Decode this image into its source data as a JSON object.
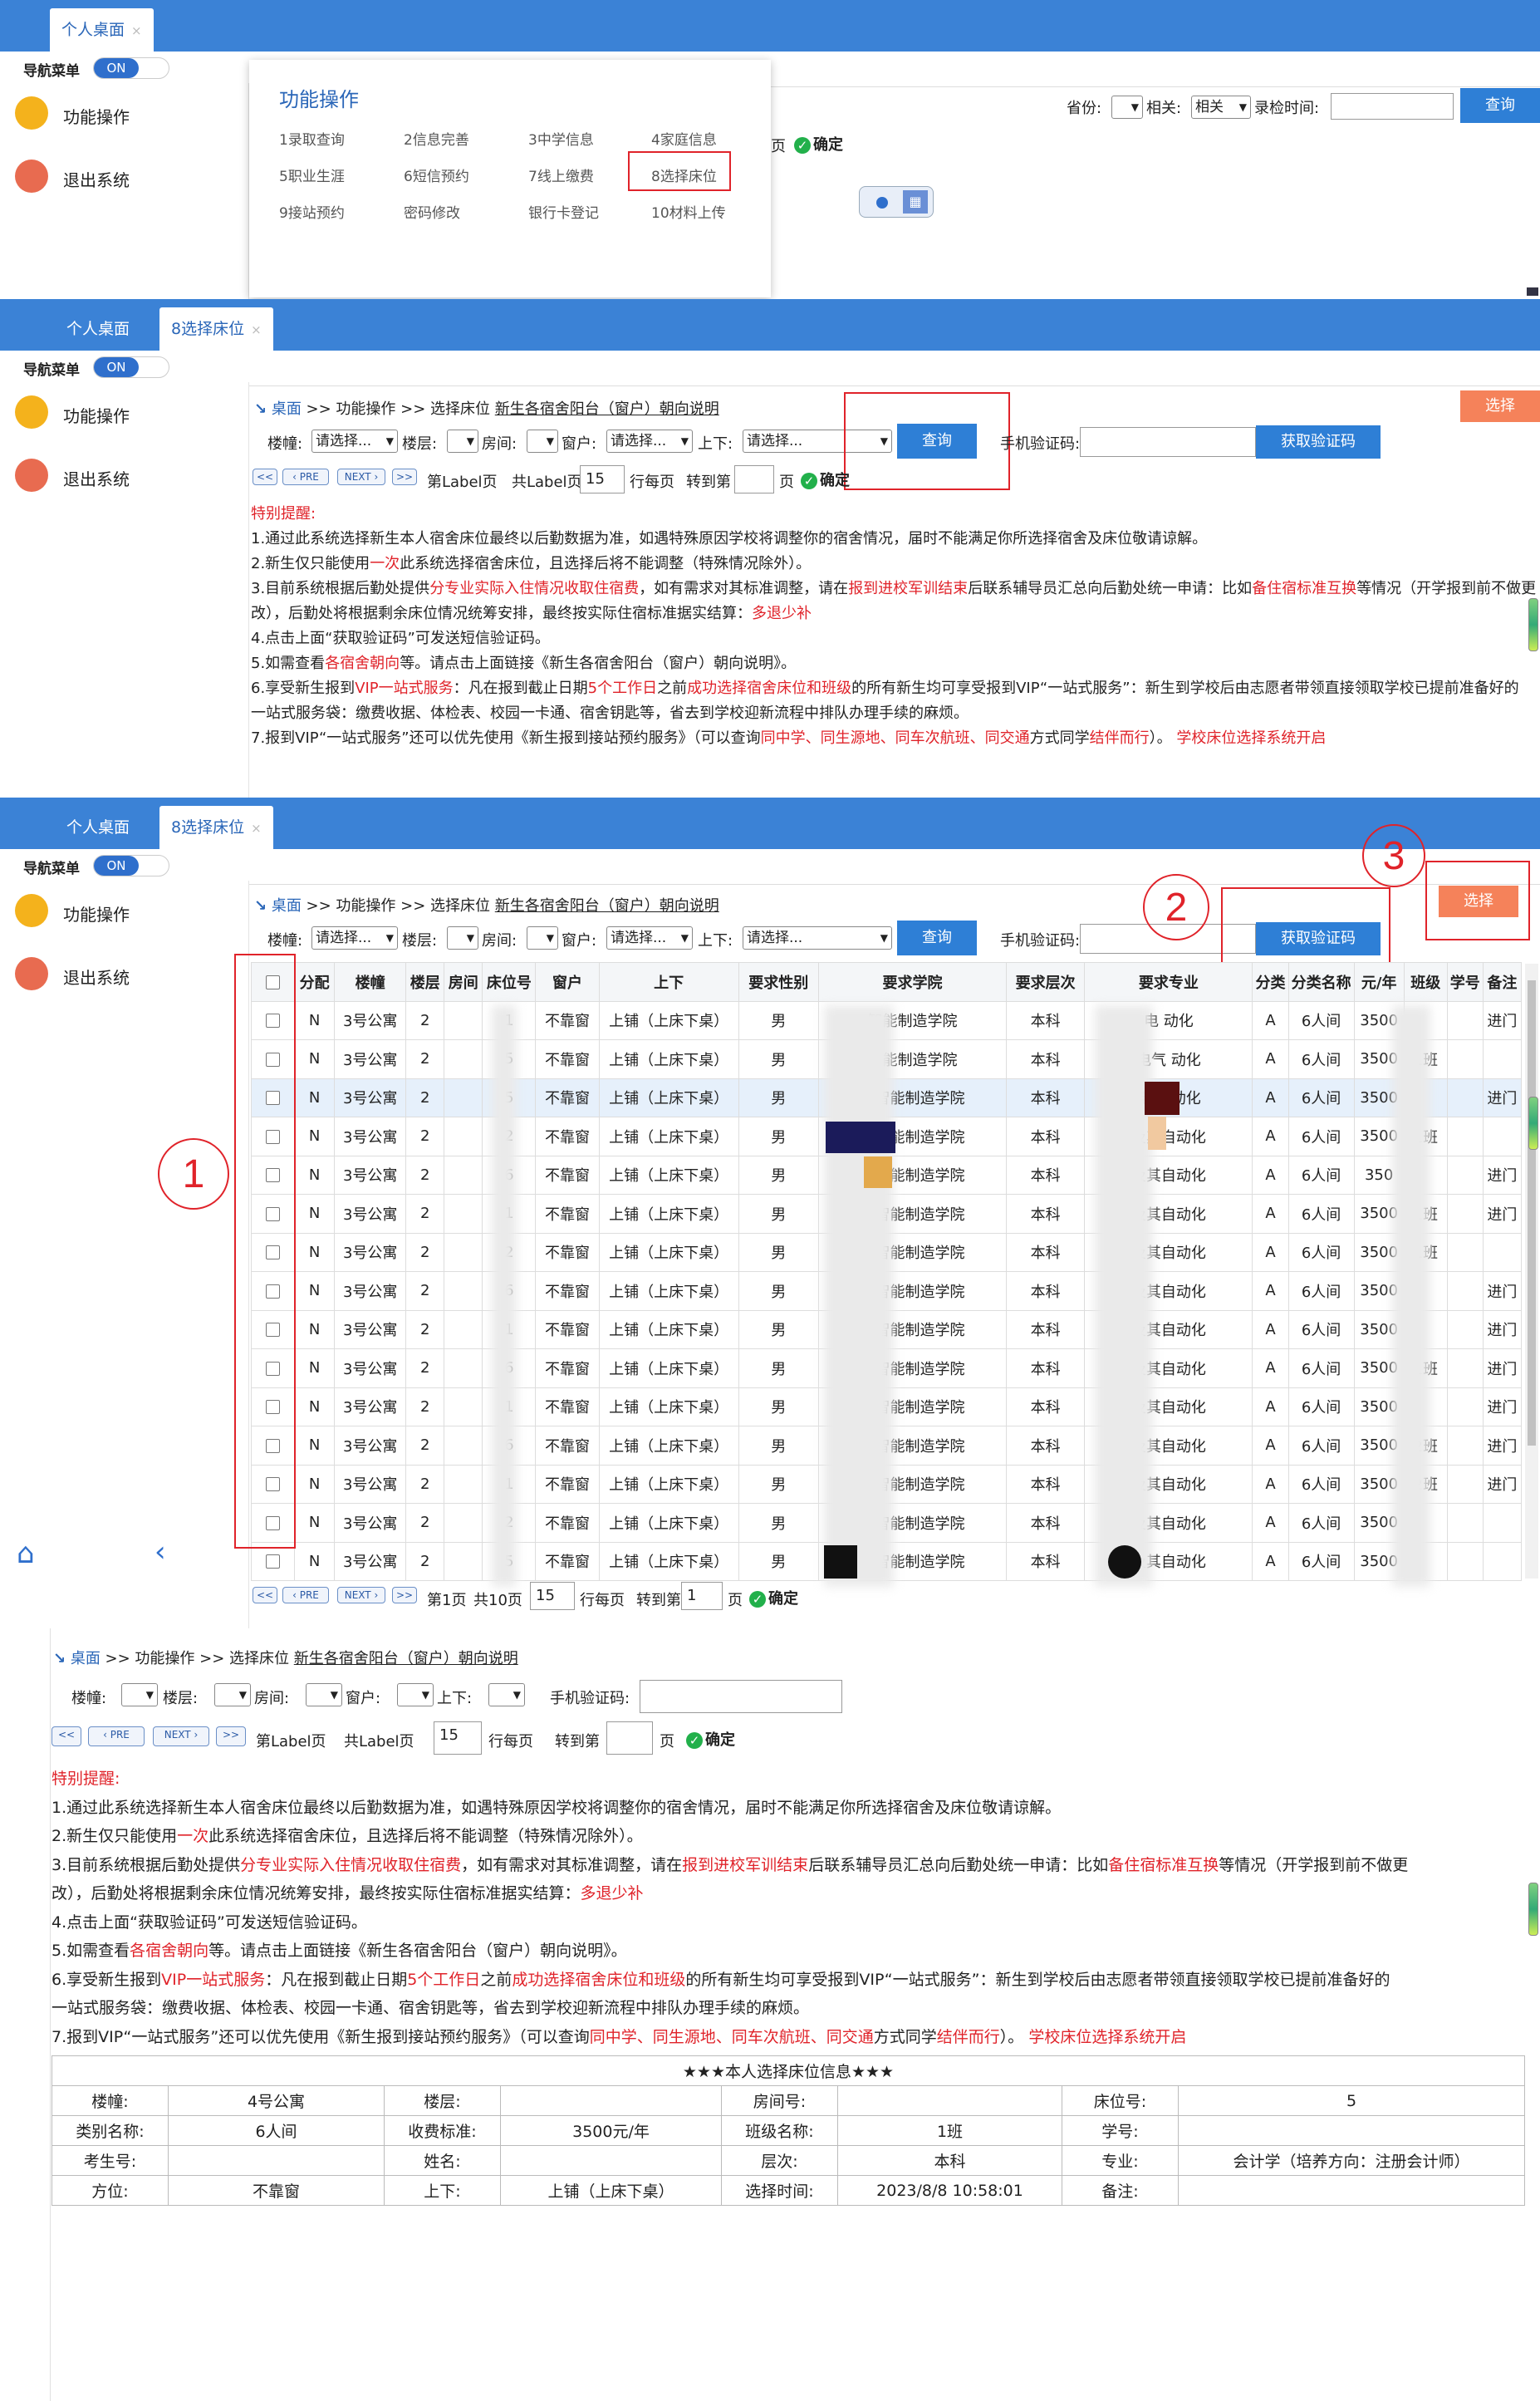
{
  "sec1": {
    "tabs": [
      {
        "label": "个人桌面",
        "close": "×"
      }
    ],
    "nav_label": "导航菜单",
    "toggle": "ON",
    "side": [
      "功能操作",
      "退出系统"
    ],
    "popup": {
      "title": "功能操作",
      "items": [
        "1录取查询",
        "2信息完善",
        "3中学信息",
        "4家庭信息",
        "5职业生涯",
        "6短信预约",
        "7线上缴费",
        "8选择床位",
        "9接站预约",
        "密码修改",
        "银行卡登记",
        "10材料上传"
      ]
    },
    "filters": {
      "province": "省份:",
      "related": "相关:",
      "related_val": "相关",
      "time": "录检时间:",
      "query": "查询"
    },
    "page_tail": "页",
    "confirm": "确定"
  },
  "sec2": {
    "tabs": [
      {
        "label": "个人桌面"
      },
      {
        "label": "8选择床位",
        "close": "×"
      }
    ],
    "nav_label": "导航菜单",
    "toggle": "ON",
    "side": [
      "功能操作",
      "退出系统"
    ],
    "crumb": {
      "desk": "桌面",
      "rest": " >> 功能操作 >> 选择床位 ",
      "link": "新生各宿舍阳台（窗户）朝向说明"
    },
    "select_btn": "选择",
    "filters": {
      "building": "楼幢:",
      "building_val": "请选择...",
      "floor": "楼层:",
      "room": "房间:",
      "window": "窗户:",
      "window_val": "请选择...",
      "updown": "上下:",
      "updown_val": "请选择...",
      "query": "查询",
      "phone": "手机验证码:",
      "get_code": "获取验证码"
    },
    "pager": {
      "prev": "PRE",
      "next": "NEXT",
      "page_label": "第Label页",
      "total_label": "共Label页",
      "per": "15",
      "per_lbl": "行每页",
      "goto": "转到第",
      "page": "页",
      "confirm": "确定"
    }
  },
  "notice": {
    "head": "特别提醒:",
    "l1": "1.通过此系统选择新生本人宿舍床位最终以后勤数据为准，如遇特殊原因学校将调整你的宿舍情况，届时不能满足你所选择宿舍及床位敬请谅解。",
    "l2a": "2.新生仅只能使用",
    "l2b": "一次",
    "l2c": "此系统选择宿舍床位，且选择后将不能调整（特殊情况除外）。",
    "l3a": "3.目前系统根据后勤处提供",
    "l3b": "分专业实际入住情况收取住宿费",
    "l3c": "，如有需求对其标准调整，请在",
    "l3d": "报到进校军训结束",
    "l3e": "后联系辅导员汇总向后勤处统一申请：比如",
    "l3f": "备住宿标准互换",
    "l3g": "等情况（开学报到前不做更",
    "l3h": "改），后勤处将根据剩余床位情况统筹安排，最终按实际住宿标准据实结算：",
    "l3i": "多退少补",
    "l4": "4.点击上面“获取验证码”可发送短信验证码。",
    "l5a": "5.如需查看",
    "l5b": "各宿舍朝向",
    "l5c": "等。请点击上面链接《新生各宿舍阳台（窗户）朝向说明》。",
    "l6a": "6.享受新生报到",
    "l6b": "VIP一站式服务",
    "l6c": "：凡在报到截止日期",
    "l6d": "5个工作日",
    "l6e": "之前",
    "l6f": "成功选择宿舍床位和班级",
    "l6g": "的所有新生均可享受报到VIP“一站式服务”：新生到学校后由志愿者带领直接领取学校已提前准备好的",
    "l6h": "一站式服务袋：缴费收据、体检表、校园一卡通、宿舍钥匙等，省去到学校迎新流程中排队办理手续的麻烦。",
    "l7a": "7.报到VIP“一站式服务”还可以优先使用《新生报到接站预约服务》（可以查询",
    "l7b": "同中学、同生源地、同车次航班、同交通",
    "l7c": "方式同学",
    "l7d": "结伴而行",
    "l7e": "）。",
    "l7f": "学校床位选择系统开启"
  },
  "sec3": {
    "tabs": [
      {
        "label": "个人桌面"
      },
      {
        "label": "8选择床位",
        "close": "×"
      }
    ],
    "nav_label": "导航菜单",
    "toggle": "ON",
    "side": [
      "功能操作",
      "退出系统"
    ],
    "crumb": {
      "desk": "桌面",
      "rest": " >> 功能操作 >> 选择床位 ",
      "link": "新生各宿舍阳台（窗户）朝向说明"
    },
    "select_btn": "选择",
    "annotations": [
      "1",
      "2",
      "3"
    ],
    "filters": {
      "building": "楼幢:",
      "building_val": "请选择...",
      "floor": "楼层:",
      "room": "房间:",
      "window": "窗户:",
      "window_val": "请选择...",
      "updown": "上下:",
      "updown_val": "请选择...",
      "query": "查询",
      "phone": "手机验证码:",
      "get_code": "获取验证码"
    },
    "columns": [
      "分配",
      "楼幢",
      "楼层",
      "房间",
      "床位号",
      "窗户",
      "上下",
      "要求性别",
      "要求学院",
      "要求层次",
      "要求专业",
      "分类",
      "分类名称",
      "元/年",
      "班级",
      "学号",
      "备注"
    ],
    "rows": [
      [
        "N",
        "3号公寓",
        "2",
        "",
        "1",
        "不靠窗",
        "上铺（上床下桌）",
        "男",
        "智能制造学院",
        "本科",
        "电  动化",
        "A",
        "6人间",
        "3500",
        "",
        "",
        "进门"
      ],
      [
        "N",
        "3号公寓",
        "2",
        "",
        "5",
        "不靠窗",
        "上铺（上床下桌）",
        "男",
        "智能制造学院",
        "本科",
        "电气  动化",
        "A",
        "6人间",
        "3500",
        "1班",
        "",
        ""
      ],
      [
        "N",
        "3号公寓",
        "2",
        "",
        "5",
        "不靠窗",
        "上铺（上床下桌）",
        "男",
        "与智能制造学院",
        "本科",
        "电  自动化",
        "A",
        "6人间",
        "3500",
        "",
        "",
        "进门"
      ],
      [
        "N",
        "3号公寓",
        "2",
        "",
        "2",
        "不靠窗",
        "上铺（上床下桌）",
        "男",
        "与智能制造学院",
        "本科",
        "及其自动化",
        "A",
        "6人间",
        "3500",
        "1班",
        "",
        ""
      ],
      [
        "N",
        "3号公寓",
        "2",
        "",
        "6",
        "不靠窗",
        "上铺（上床下桌）",
        "男",
        "与智能制造学院",
        "本科",
        "及其自动化",
        "A",
        "6人间",
        "350",
        "",
        "",
        "进门"
      ],
      [
        "N",
        "3号公寓",
        "2",
        "",
        "1",
        "不靠窗",
        "上铺（上床下桌）",
        "男",
        "与智能制造学院",
        "本科",
        "及其自动化",
        "A",
        "6人间",
        "3500",
        "1班",
        "",
        "进门"
      ],
      [
        "N",
        "3号公寓",
        "2",
        "",
        "2",
        "不靠窗",
        "上铺（上床下桌）",
        "男",
        "与智能制造学院",
        "本科",
        "及其自动化",
        "A",
        "6人间",
        "3500",
        "1班",
        "",
        ""
      ],
      [
        "N",
        "3号公寓",
        "2",
        "",
        "6",
        "不靠窗",
        "上铺（上床下桌）",
        "男",
        "与智能制造学院",
        "本科",
        "及其自动化",
        "A",
        "6人间",
        "3500",
        "",
        "",
        "进门"
      ],
      [
        "N",
        "3号公寓",
        "2",
        "",
        "1",
        "不靠窗",
        "上铺（上床下桌）",
        "男",
        "与智能制造学院",
        "本科",
        "及其自动化",
        "A",
        "6人间",
        "3500",
        "",
        "",
        "进门"
      ],
      [
        "N",
        "3号公寓",
        "2",
        "",
        "6",
        "不靠窗",
        "上铺（上床下桌）",
        "男",
        "与智能制造学院",
        "本科",
        "及其自动化",
        "A",
        "6人间",
        "3500",
        "1班",
        "",
        "进门"
      ],
      [
        "N",
        "3号公寓",
        "2",
        "",
        "1",
        "不靠窗",
        "上铺（上床下桌）",
        "男",
        "与智能制造学院",
        "本科",
        "及其自动化",
        "A",
        "6人间",
        "3500",
        "",
        "",
        "进门"
      ],
      [
        "N",
        "3号公寓",
        "2",
        "",
        "6",
        "不靠窗",
        "上铺（上床下桌）",
        "男",
        "与智能制造学院",
        "本科",
        "及其自动化",
        "A",
        "6人间",
        "3500",
        "2班",
        "",
        "进门"
      ],
      [
        "N",
        "3号公寓",
        "2",
        "",
        "1",
        "不靠窗",
        "上铺（上床下桌）",
        "男",
        "与智能制造学院",
        "本科",
        "及其自动化",
        "A",
        "6人间",
        "3500",
        "2班",
        "",
        "进门"
      ],
      [
        "N",
        "3号公寓",
        "2",
        "",
        "2",
        "不靠窗",
        "上铺（上床下桌）",
        "男",
        "与智能制造学院",
        "本科",
        "及其自动化",
        "A",
        "6人间",
        "3500",
        "",
        "",
        ""
      ],
      [
        "N",
        "3号公寓",
        "2",
        "",
        "5",
        "不靠窗",
        "上铺（上床下桌）",
        "男",
        "与智能制造学院",
        "本科",
        "及其自动化",
        "A",
        "6人间",
        "3500",
        "",
        "",
        ""
      ]
    ],
    "pager": {
      "prev": "PRE",
      "next": "NEXT",
      "page_label": "第1页",
      "total_label": "共10页",
      "per": "15",
      "per_lbl": "行每页",
      "goto": "转到第",
      "page_val": "1",
      "page": "页",
      "confirm": "确定"
    }
  },
  "sec4": {
    "crumb": {
      "desk": "桌面",
      "rest": " >> 功能操作 >> 选择床位 ",
      "link": "新生各宿舍阳台（窗户）朝向说明"
    },
    "filters": {
      "building": "楼幢:",
      "floor": "楼层:",
      "room": "房间:",
      "window": "窗户:",
      "updown": "上下:",
      "phone": "手机验证码:"
    },
    "pager": {
      "prev": "PRE",
      "next": "NEXT",
      "page_label": "第Label页",
      "total_label": "共Label页",
      "per": "15",
      "per_lbl": "行每页",
      "goto": "转到第",
      "page": "页",
      "confirm": "确定"
    },
    "info": {
      "title": "★★★本人选择床位信息★★★",
      "r1": [
        "楼幢:",
        "4号公寓",
        "楼层:",
        "",
        "房间号:",
        "",
        "床位号:",
        "5"
      ],
      "r2": [
        "类别名称:",
        "6人间",
        "收费标准:",
        "3500元/年",
        "班级名称:",
        "1班",
        "学号:",
        ""
      ],
      "r3": [
        "考生号:",
        "",
        "姓名:",
        "",
        "层次:",
        "本科",
        "专业:",
        "会计学（培养方向：注册会计师）"
      ],
      "r4": [
        "方位:",
        "不靠窗",
        "上下:",
        "上铺（上床下桌）",
        "选择时间:",
        "2023/8/8 10:58:01",
        "备注:",
        ""
      ]
    }
  }
}
